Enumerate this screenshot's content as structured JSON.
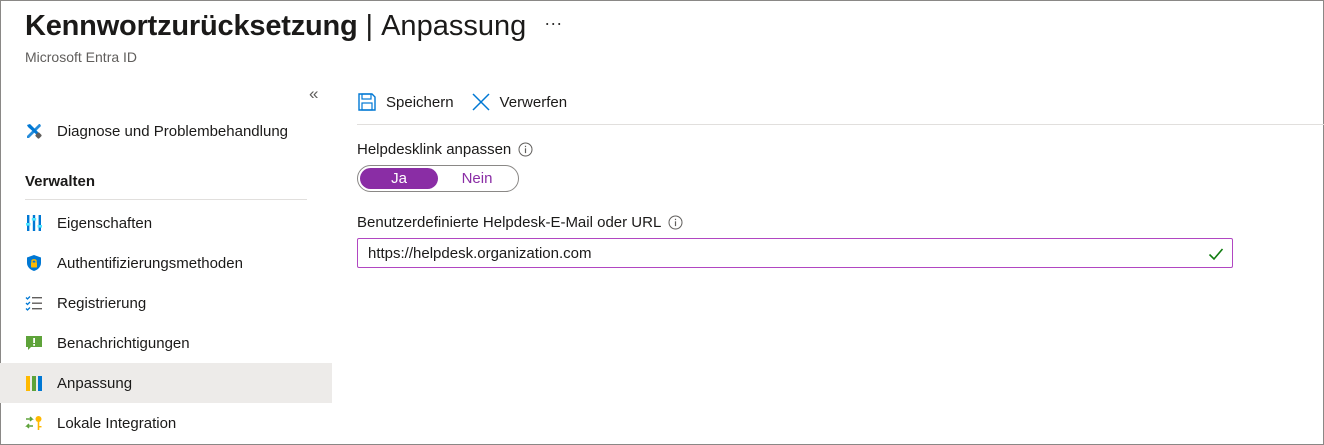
{
  "header": {
    "title": "Kennwortzurücksetzung",
    "separator": "|",
    "section": "Anpassung",
    "more": "···",
    "subtitle": "Microsoft Entra ID"
  },
  "sidebar": {
    "collapse_glyph": "«",
    "top_items": [
      {
        "label": "Diagnose und Problembehandlung",
        "icon": "wrench-screwdriver-icon"
      }
    ],
    "section_title": "Verwalten",
    "items": [
      {
        "label": "Eigenschaften",
        "icon": "properties-icon",
        "active": false
      },
      {
        "label": "Authentifizierungsmethoden",
        "icon": "shield-lock-icon",
        "active": false
      },
      {
        "label": "Registrierung",
        "icon": "checklist-icon",
        "active": false
      },
      {
        "label": "Benachrichtigungen",
        "icon": "notification-icon",
        "active": false
      },
      {
        "label": "Anpassung",
        "icon": "customization-icon",
        "active": true
      },
      {
        "label": "Lokale Integration",
        "icon": "sync-key-icon",
        "active": false
      }
    ]
  },
  "toolbar": {
    "save_label": "Speichern",
    "discard_label": "Verwerfen"
  },
  "form": {
    "helpdesk_label": "Helpdesklink anpassen",
    "toggle_yes": "Ja",
    "toggle_no": "Nein",
    "toggle_selected": "Ja",
    "url_label": "Benutzerdefinierte Helpdesk-E-Mail oder URL",
    "url_value": "https://helpdesk.organization.com"
  },
  "colors": {
    "accent": "#8a2da5",
    "input_border": "#b146c2",
    "azure_blue": "#0078d4",
    "valid_green": "#107c10",
    "active_bg": "#edebe9"
  }
}
